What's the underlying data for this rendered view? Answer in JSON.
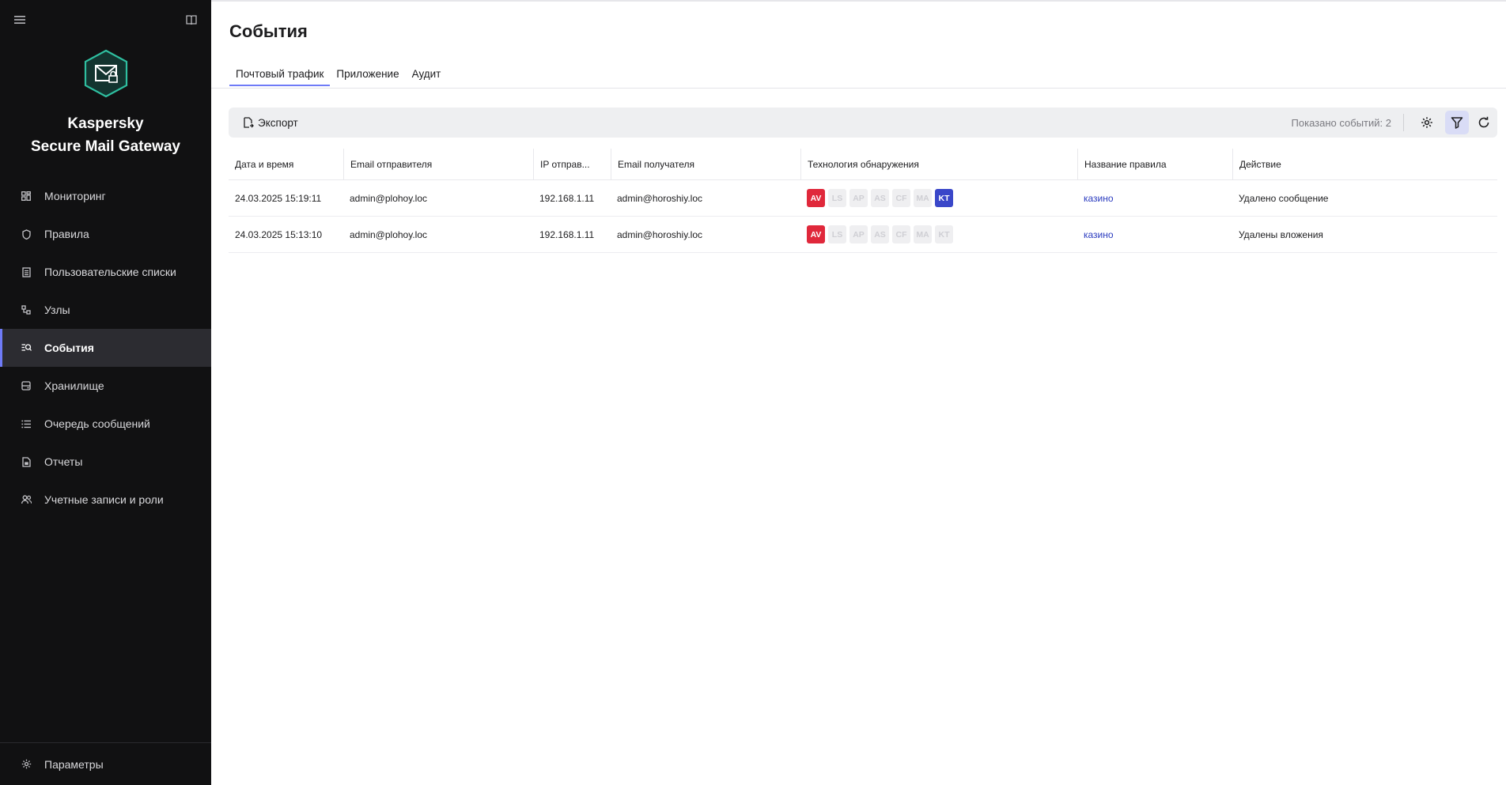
{
  "sidebar": {
    "brand_line1": "Kaspersky",
    "brand_line2": "Secure Mail Gateway",
    "items": [
      {
        "label": "Мониторинг",
        "icon": "dashboard-icon"
      },
      {
        "label": "Правила",
        "icon": "shield-icon"
      },
      {
        "label": "Пользовательские списки",
        "icon": "list-doc-icon"
      },
      {
        "label": "Узлы",
        "icon": "nodes-icon"
      },
      {
        "label": "События",
        "icon": "events-search-icon",
        "active": true
      },
      {
        "label": "Хранилище",
        "icon": "storage-icon"
      },
      {
        "label": "Очередь сообщений",
        "icon": "queue-list-icon"
      },
      {
        "label": "Отчеты",
        "icon": "report-icon"
      },
      {
        "label": "Учетные записи и роли",
        "icon": "users-icon"
      }
    ],
    "settings_label": "Параметры"
  },
  "page": {
    "title": "События",
    "tabs": [
      "Почтовый трафик",
      "Приложение",
      "Аудит"
    ]
  },
  "toolbar": {
    "export_label": "Экспорт",
    "shown_text": "Показано событий: 2"
  },
  "table": {
    "columns": [
      "Дата и время",
      "Email отправителя",
      "IP отправ...",
      "Email получателя",
      "Технология обнаружения",
      "Название правила",
      "Действие"
    ],
    "rows": [
      {
        "datetime": "24.03.2025 15:19:11",
        "sender": "admin@plohoy.loc",
        "ip": "192.168.1.11",
        "recipient": "admin@horoshiy.loc",
        "rule": "казино",
        "action": "Удалено сообщение",
        "badges": [
          "AV",
          "LS",
          "AP",
          "AS",
          "CF",
          "MA",
          "KT"
        ],
        "active_badges": [
          "AV",
          "KT"
        ]
      },
      {
        "datetime": "24.03.2025 15:13:10",
        "sender": "admin@plohoy.loc",
        "ip": "192.168.1.11",
        "recipient": "admin@horoshiy.loc",
        "rule": "казино",
        "action": "Удалены вложения",
        "badges": [
          "AV",
          "LS",
          "AP",
          "AS",
          "CF",
          "MA",
          "KT"
        ],
        "active_badges": [
          "AV"
        ]
      }
    ]
  },
  "colors": {
    "sidebar_bg": "#111112",
    "accent": "#6f7bf7",
    "badge_av": "#e0283b",
    "badge_kt": "#3a47c9",
    "link": "#2a3bbf"
  }
}
